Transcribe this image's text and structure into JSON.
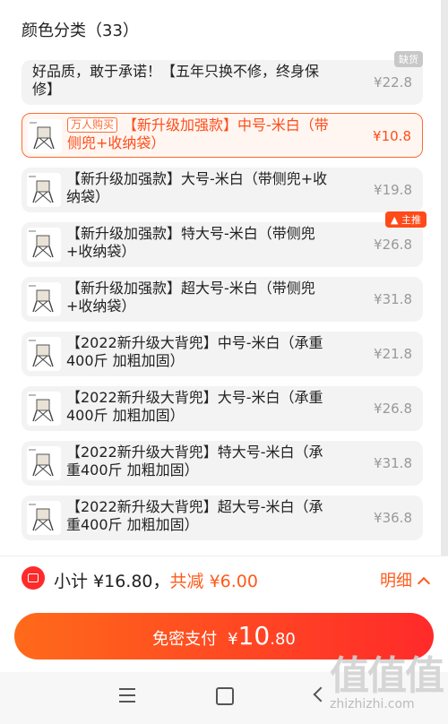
{
  "section": {
    "title": "颜色分类（33）"
  },
  "items": [
    {
      "name": "好品质，敢于承诺！【五年只换不修，终身保修】",
      "price": "¥22.8",
      "badge": "缺货"
    },
    {
      "tag": "万人购买",
      "name": "【新升级加强款】中号-米白（带侧兜+收纳袋）",
      "price": "¥10.8"
    },
    {
      "name": "【新升级加强款】大号-米白（带侧兜+收纳袋）",
      "price": "¥19.8"
    },
    {
      "name": "【新升级加强款】特大号-米白（带侧兜+收纳袋）",
      "price": "¥26.8",
      "badge": "主推"
    },
    {
      "name": "【新升级加强款】超大号-米白（带侧兜+收纳袋）",
      "price": "¥31.8"
    },
    {
      "name": "【2022新升级大背兜】中号-米白（承重400斤 加粗加固）",
      "price": "¥21.8"
    },
    {
      "name": "【2022新升级大背兜】大号-米白（承重400斤 加粗加固）",
      "price": "¥26.8"
    },
    {
      "name": "【2022新升级大背兜】特大号-米白（承重400斤 加粗加固）",
      "price": "¥31.8"
    },
    {
      "name": "【2022新升级大背兜】超大号-米白（承重400斤 加粗加固）",
      "price": "¥36.8"
    }
  ],
  "footer": {
    "subtotal": "小计 ¥16.80，",
    "discount": "共减 ¥6.00",
    "detail": "明细",
    "pay_label": "免密支付",
    "pay_currency": "¥",
    "pay_int": "10",
    "pay_dec": ".80"
  },
  "watermark": {
    "big": "值值值",
    "small": "zhizhizhi.com"
  },
  "colors": {
    "accent": "#ff5a1a",
    "pay_start": "#ff6a1a",
    "pay_end": "#ff2a2a",
    "out_badge": "#c8c8c8"
  },
  "icons": {
    "coupon": "coupon-icon",
    "flame": "flame-icon",
    "menu": "menu-icon",
    "home": "home-icon",
    "back": "back-icon"
  }
}
